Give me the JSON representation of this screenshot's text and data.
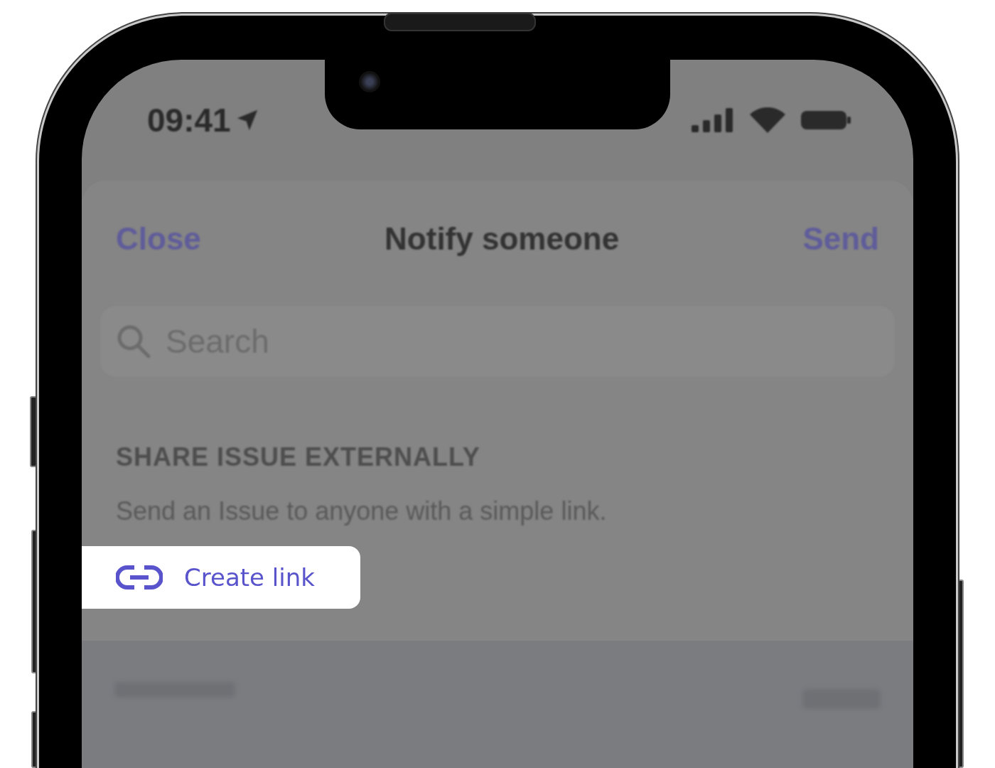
{
  "status_bar": {
    "time": "09:41"
  },
  "header": {
    "close": "Close",
    "title": "Notify someone",
    "send": "Send"
  },
  "search": {
    "placeholder": "Search"
  },
  "section": {
    "heading": "SHARE ISSUE EXTERNALLY",
    "description": "Send an Issue to anyone with a simple link."
  },
  "create_link_button": {
    "label": "Create link"
  }
}
